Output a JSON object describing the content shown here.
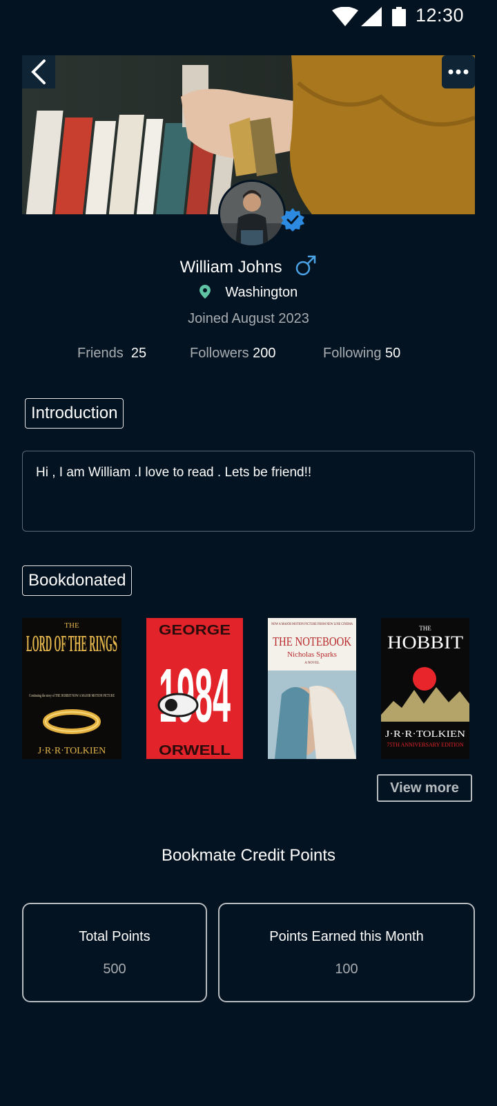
{
  "status_bar": {
    "time": "12:30",
    "icons": [
      "wifi-icon",
      "signal-icon",
      "battery-icon"
    ]
  },
  "header": {
    "back_icon": "chevron-left-icon",
    "more_icon": "more-horizontal-icon"
  },
  "profile": {
    "name": "William Johns",
    "gender_icon": "male-icon",
    "verified_icon": "verified-badge-icon",
    "location": "Washington",
    "joined": "Joined August 2023"
  },
  "stats": {
    "friends_label": "Friends",
    "friends_value": "25",
    "followers_label": "Followers",
    "followers_value": "200",
    "following_label": "Following",
    "following_value": "50"
  },
  "introduction": {
    "label": "Introduction",
    "text": "Hi , I am William .I love to read . Lets be friend!!"
  },
  "books": {
    "label": "Bookdonated",
    "items": [
      {
        "title_top": "THE",
        "title_main": "LORD OF THE RINGS",
        "author": "J·R·R·TOLKIEN",
        "tagline": "Continuing the story of THE HOBBIT NOW A MAJOR MOTION PICTURE"
      },
      {
        "title_top": "GEORGE",
        "title_main": "1984",
        "author": "ORWELL"
      },
      {
        "title_top": "NOW A MAJOR MOTION PICTURE FROM NEW LINE CINEMA",
        "title_main": "THE NOTEBOOK",
        "author": "Nicholas Sparks",
        "tagline": "A NOVEL"
      },
      {
        "title_top": "THE",
        "title_main": "HOBBIT",
        "author": "J·R·R·TOLKIEN",
        "tagline": "75TH ANNIVERSARY EDITION"
      }
    ],
    "view_more": "View more"
  },
  "credits": {
    "title": "Bookmate Credit Points",
    "total_label": "Total Points",
    "total_value": "500",
    "month_label": "Points Earned this Month",
    "month_value": "100"
  },
  "colors": {
    "background": "#041321",
    "button_bg": "#0f2536",
    "muted_text": "#a8adb2",
    "verified_blue": "#2c8be0",
    "location_green": "#5ec2a3"
  }
}
